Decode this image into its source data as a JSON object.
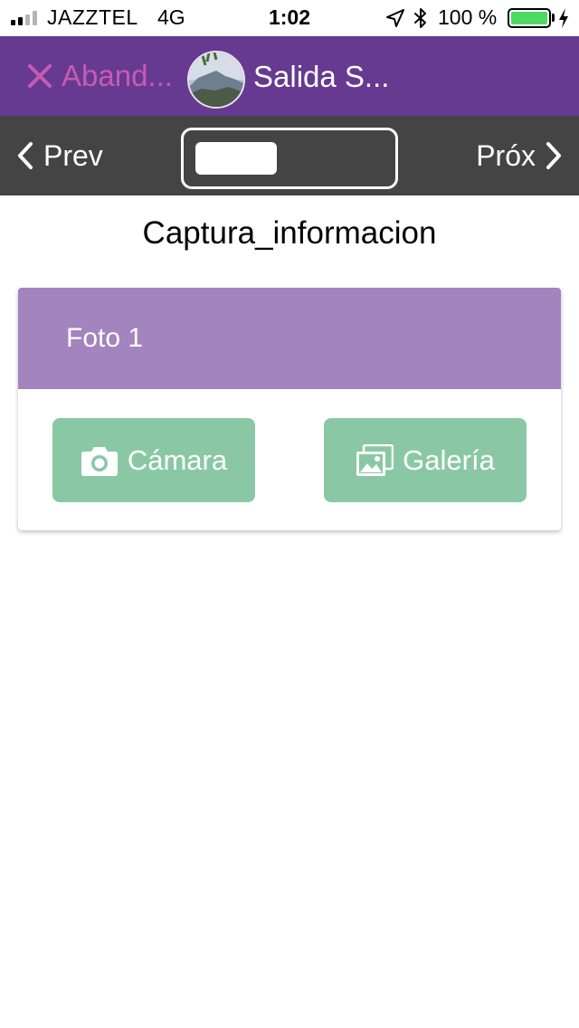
{
  "status_bar": {
    "carrier": "JAZZTEL",
    "network": "4G",
    "time": "1:02",
    "battery_percent": "100 %",
    "battery_level": 1.0,
    "signal_bars": 2,
    "icons": [
      "signal-icon",
      "location-arrow-icon",
      "bluetooth-icon",
      "battery-icon",
      "charging-icon"
    ]
  },
  "header": {
    "abandon_label": "Aband...",
    "title": "Salida S...",
    "icons": [
      "close-icon",
      "avatar-image"
    ]
  },
  "nav": {
    "prev_label": "Prev",
    "next_label": "Próx",
    "icons": [
      "chevron-left-icon",
      "chevron-right-icon"
    ]
  },
  "form": {
    "title": "Captura_informacion",
    "section": {
      "title": "Foto 1",
      "camera_label": "Cámara",
      "gallery_label": "Galería",
      "icons": [
        "camera-icon",
        "images-icon"
      ]
    }
  },
  "colors": {
    "header_bg": "#663a90",
    "abandon": "#c75ab4",
    "navbar_bg": "#444444",
    "card_header_bg": "#a384be",
    "button_bg": "#8ac8a5",
    "battery_fill": "#4cd964"
  }
}
